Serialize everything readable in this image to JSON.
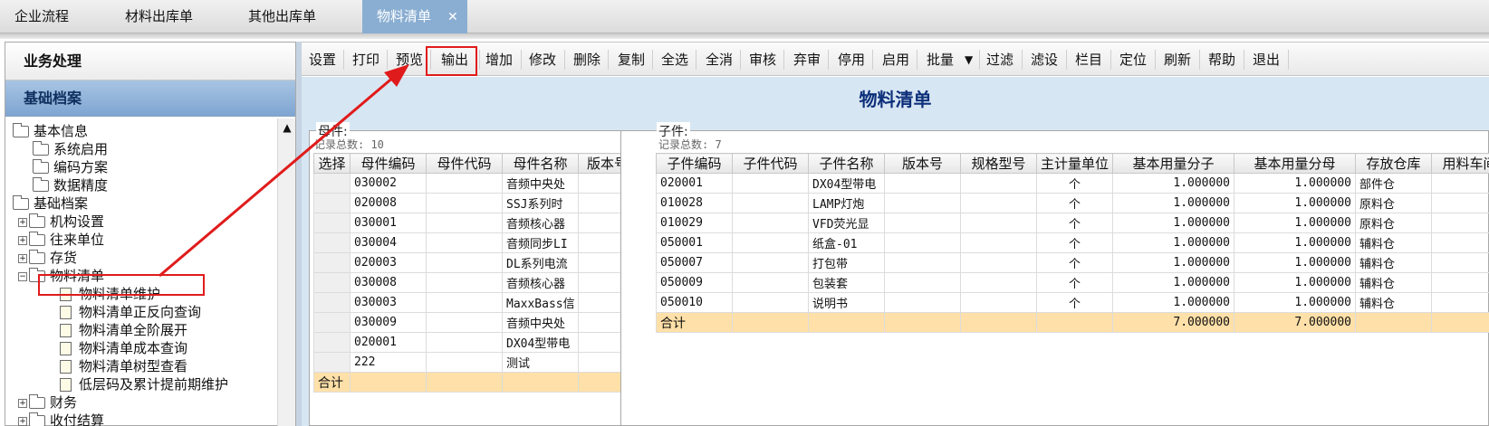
{
  "tabs": [
    {
      "label": "企业流程"
    },
    {
      "label": "材料出库单"
    },
    {
      "label": "其他出库单"
    },
    {
      "label": "物料清单",
      "close": "✕"
    }
  ],
  "sidebar": {
    "section1": "业务处理",
    "section2": "基础档案",
    "tree": [
      {
        "label": "基本信息"
      },
      {
        "label": "系统启用"
      },
      {
        "label": "编码方案"
      },
      {
        "label": "数据精度"
      },
      {
        "label": "基础档案"
      },
      {
        "label": "机构设置"
      },
      {
        "label": "往来单位"
      },
      {
        "label": "存货"
      },
      {
        "label": "物料清单"
      },
      {
        "label": "物料清单维护"
      },
      {
        "label": "物料清单正反向查询"
      },
      {
        "label": "物料清单全阶展开"
      },
      {
        "label": "物料清单成本查询"
      },
      {
        "label": "物料清单树型查看"
      },
      {
        "label": "低层码及累计提前期维护"
      },
      {
        "label": "财务"
      },
      {
        "label": "收付结算"
      }
    ]
  },
  "toolbar": {
    "buttons": [
      "设置",
      "打印",
      "预览",
      "输出",
      "增加",
      "修改",
      "删除",
      "复制",
      "全选",
      "全消",
      "审核",
      "弃审",
      "停用",
      "启用",
      "批量",
      "过滤",
      "滤设",
      "栏目",
      "定位",
      "刷新",
      "帮助",
      "退出"
    ]
  },
  "main": {
    "title": "物料清单",
    "parent": {
      "label": "母件:",
      "count": "记录总数: 10",
      "headers": [
        "选择",
        "母件编码",
        "母件代码",
        "母件名称",
        "版本号"
      ],
      "rows": [
        [
          "",
          "030002",
          "",
          "音频中央处",
          ""
        ],
        [
          "",
          "020008",
          "",
          "SSJ系列时",
          ""
        ],
        [
          "",
          "030001",
          "",
          "音频核心器",
          ""
        ],
        [
          "",
          "030004",
          "",
          "音频同步LI",
          ""
        ],
        [
          "",
          "020003",
          "",
          "DL系列电流",
          ""
        ],
        [
          "",
          "030008",
          "",
          "音频核心器",
          ""
        ],
        [
          "",
          "030003",
          "",
          "MaxxBass信",
          ""
        ],
        [
          "",
          "030009",
          "",
          "音频中央处",
          ""
        ],
        [
          "",
          "020001",
          "",
          "DX04型带电",
          ""
        ],
        [
          "",
          "222",
          "",
          "测试",
          ""
        ]
      ],
      "total_label": "合计"
    },
    "child": {
      "label": "子件:",
      "count": "记录总数: 7",
      "headers": [
        "子件编码",
        "子件代码",
        "子件名称",
        "版本号",
        "规格型号",
        "主计量单位",
        "基本用量分子",
        "基本用量分母",
        "存放仓库",
        "用料车间"
      ],
      "rows": [
        [
          "020001",
          "",
          "DX04型带电",
          "",
          "",
          "个",
          "1.000000",
          "1.000000",
          "部件仓",
          ""
        ],
        [
          "010028",
          "",
          "LAMP灯炮",
          "",
          "",
          "个",
          "1.000000",
          "1.000000",
          "原料仓",
          ""
        ],
        [
          "010029",
          "",
          "VFD荧光显",
          "",
          "",
          "个",
          "1.000000",
          "1.000000",
          "原料仓",
          ""
        ],
        [
          "050001",
          "",
          "纸盒-01",
          "",
          "",
          "个",
          "1.000000",
          "1.000000",
          "辅料仓",
          ""
        ],
        [
          "050007",
          "",
          "打包带",
          "",
          "",
          "个",
          "1.000000",
          "1.000000",
          "辅料仓",
          ""
        ],
        [
          "050009",
          "",
          "包装套",
          "",
          "",
          "个",
          "1.000000",
          "1.000000",
          "辅料仓",
          ""
        ],
        [
          "050010",
          "",
          "说明书",
          "",
          "",
          "个",
          "1.000000",
          "1.000000",
          "辅料仓",
          ""
        ]
      ],
      "total": [
        "合计",
        "",
        "",
        "",
        "",
        "",
        "7.000000",
        "7.000000",
        "",
        ""
      ]
    }
  },
  "colors": {
    "annotation": "#e01b1b",
    "title": "#0c2f7a",
    "total_row": "#ffe0a8",
    "active_tab": "#8aaed2"
  }
}
